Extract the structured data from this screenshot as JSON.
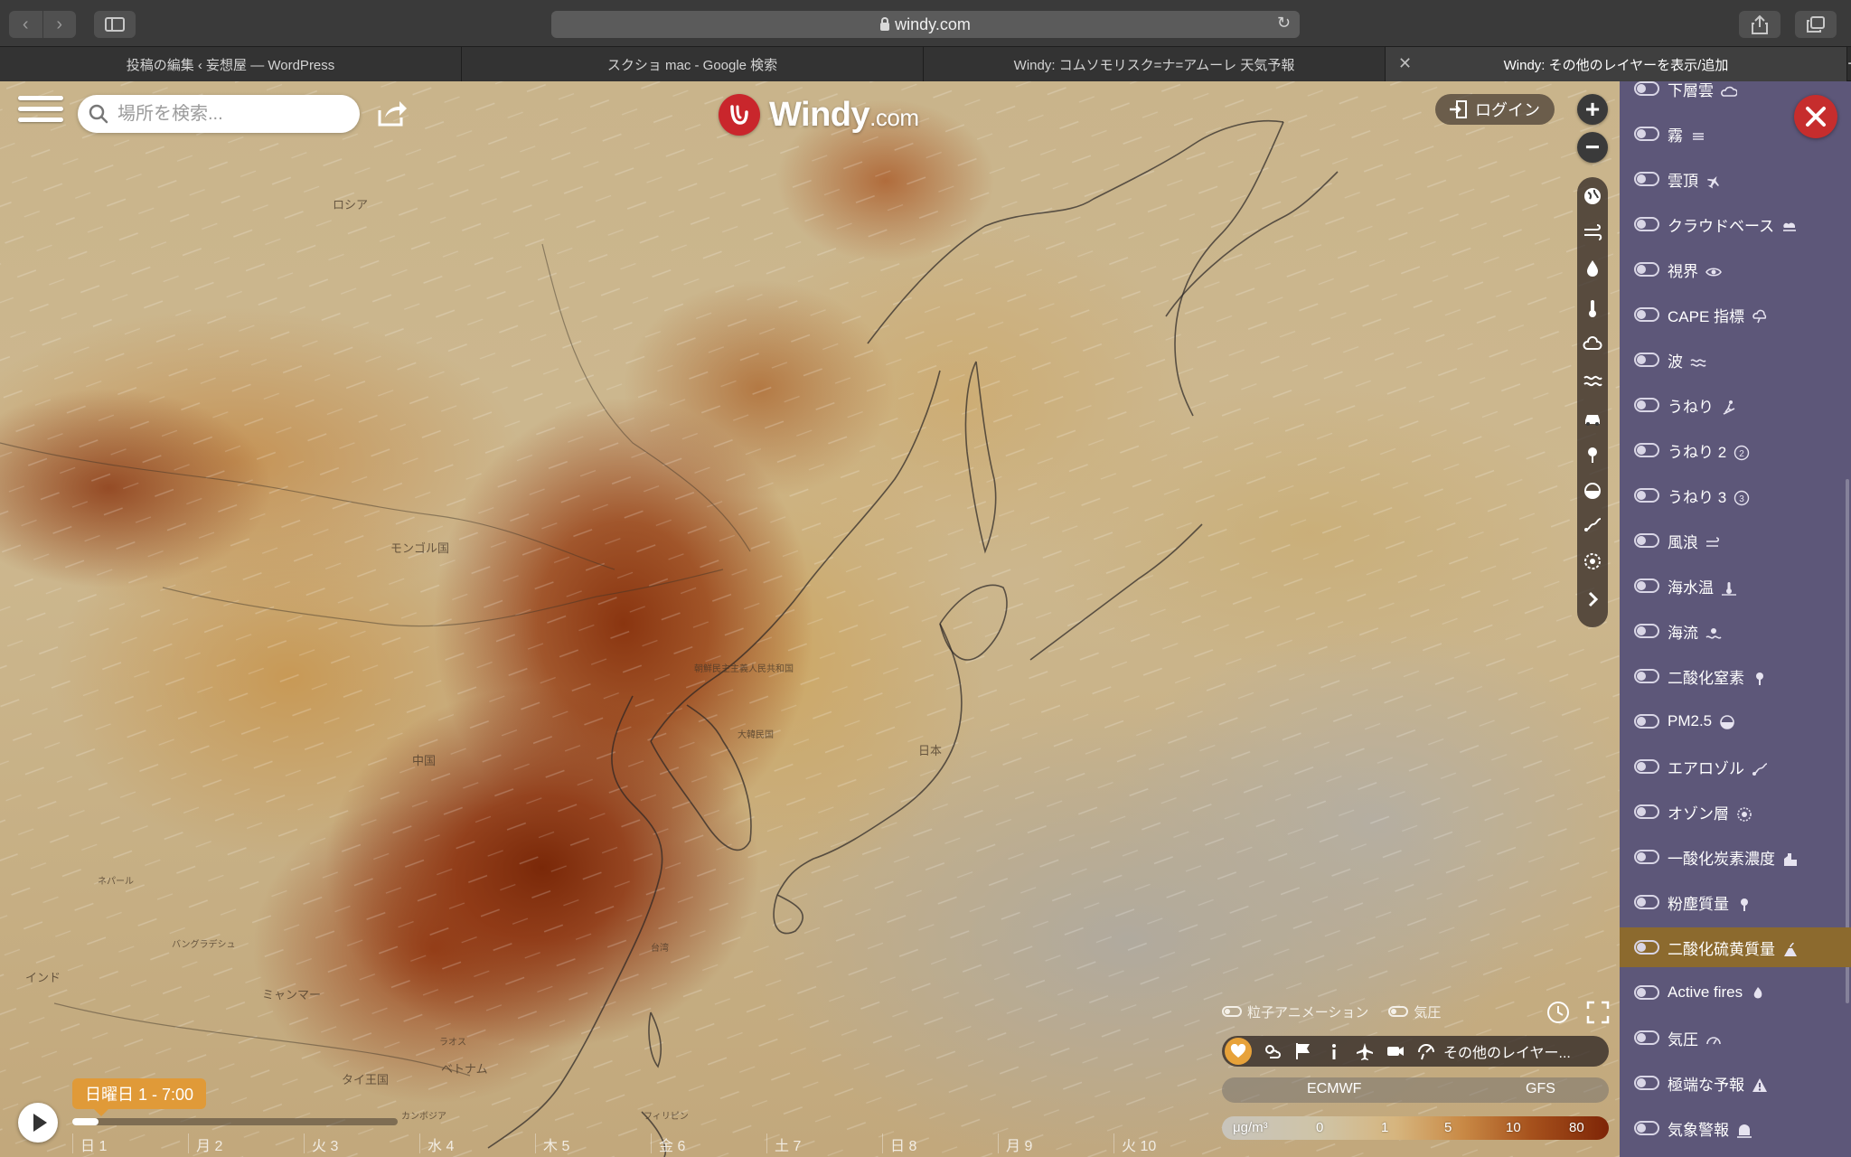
{
  "browser": {
    "url": "windy.com",
    "tabs": [
      {
        "title": "投稿の編集 ‹ 妄想屋 — WordPress"
      },
      {
        "title": "スクショ mac - Google 検索"
      },
      {
        "title": "Windy: コムソモリスク=ナ=アムーレ 天気予報"
      },
      {
        "title": "Windy: その他のレイヤーを表示/追加"
      }
    ],
    "new_tab_label": "+"
  },
  "header": {
    "search_placeholder": "場所を検索...",
    "logo_text": "Windy",
    "logo_suffix": ".com",
    "login_label": "ログイン"
  },
  "map_labels": {
    "russia": "ロシア",
    "mongolia": "モンゴル国",
    "china": "中国",
    "dprk": "朝鮮民主主義人民共和国",
    "korea": "大韓民国",
    "japan": "日本",
    "nepal": "ネパール",
    "bangladesh": "バングラデシュ",
    "india": "インド",
    "myanmar": "ミャンマー",
    "laos": "ラオス",
    "thailand": "タイ王国",
    "vietnam": "ベトナム",
    "cambodia": "カンボジア",
    "taiwan": "台湾",
    "philippines": "フィリピン"
  },
  "layers": [
    {
      "label": "下層雲",
      "icon": "cloud-low-icon"
    },
    {
      "label": "霧",
      "icon": "fog-icon"
    },
    {
      "label": "雲頂",
      "icon": "plane-icon"
    },
    {
      "label": "クラウドベース",
      "icon": "cloud-base-icon"
    },
    {
      "label": "視界",
      "icon": "eye-icon"
    },
    {
      "label": "CAPE 指標",
      "icon": "storm-icon"
    },
    {
      "label": "波",
      "icon": "waves-icon"
    },
    {
      "label": "うねり",
      "icon": "surfer-icon"
    },
    {
      "label": "うねり 2",
      "icon": "number-2-icon"
    },
    {
      "label": "うねり 3",
      "icon": "number-3-icon"
    },
    {
      "label": "風浪",
      "icon": "wind-waves-icon"
    },
    {
      "label": "海水温",
      "icon": "sea-temperature-icon"
    },
    {
      "label": "海流",
      "icon": "ocean-current-icon"
    },
    {
      "label": "二酸化窒素",
      "icon": "no2-icon"
    },
    {
      "label": "PM2.5",
      "icon": "pm25-icon"
    },
    {
      "label": "エアロゾル",
      "icon": "aerosol-icon"
    },
    {
      "label": "オゾン層",
      "icon": "ozone-icon"
    },
    {
      "label": "一酸化炭素濃度",
      "icon": "factory-icon"
    },
    {
      "label": "粉塵質量",
      "icon": "dust-icon"
    },
    {
      "label": "二酸化硫黄質量",
      "icon": "volcano-icon",
      "selected": true
    },
    {
      "label": "Active fires",
      "icon": "fire-icon"
    },
    {
      "label": "気圧",
      "icon": "gauge-icon"
    },
    {
      "label": "極端な予報",
      "icon": "warning-icon"
    },
    {
      "label": "気象警報",
      "icon": "alert-icon"
    }
  ],
  "bottom": {
    "particles_label": "粒子アニメーション",
    "pressure_label": "気圧",
    "more_layers_label": "その他のレイヤー...",
    "model_left": "ECMWF",
    "model_right": "GFS",
    "legend_unit": "μg/m³",
    "legend_values": [
      "0",
      "1",
      "5",
      "10",
      "80"
    ]
  },
  "timeline": {
    "current": "日曜日 1 - 7:00",
    "progress": 0.08,
    "days": [
      "日 1",
      "月 2",
      "火 3",
      "水 4",
      "木 5",
      "金 6",
      "土 7",
      "日 8",
      "月 9",
      "火 10"
    ]
  },
  "colors": {
    "panel": "#5d5779",
    "selected_layer": "#8c6a2e",
    "accent": "#e09a38",
    "close": "#c62d2d"
  }
}
